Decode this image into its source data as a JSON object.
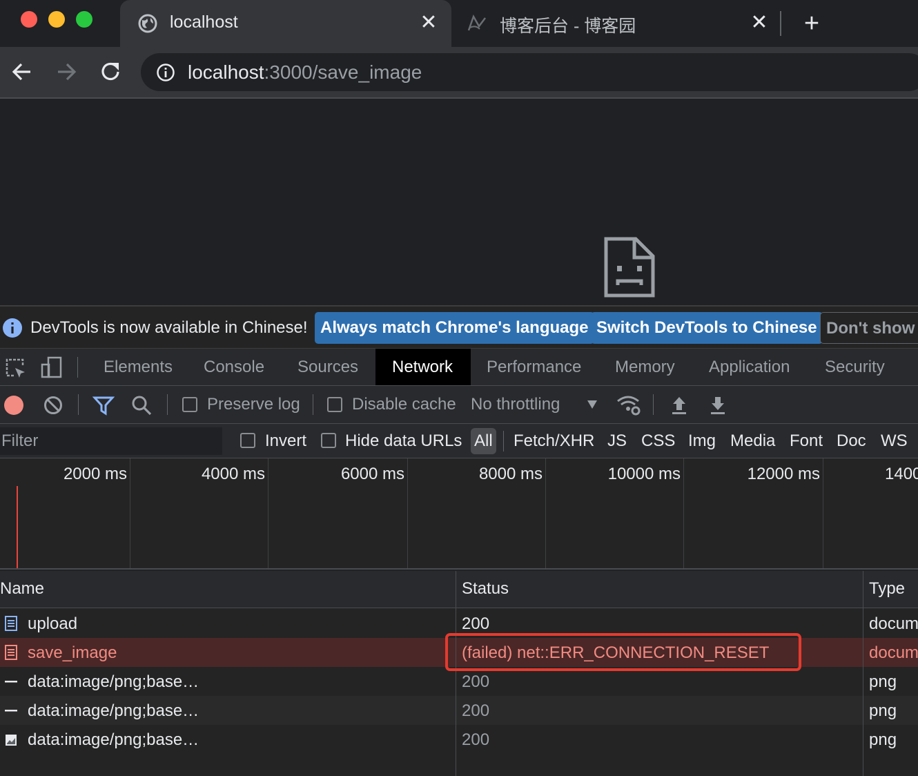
{
  "browser": {
    "tabs": [
      {
        "title": "localhost",
        "active": true
      },
      {
        "title": "博客后台 - 博客园",
        "active": false
      }
    ],
    "url": {
      "host": "localhost",
      "rest": ":3000/save_image"
    }
  },
  "infobar": {
    "message": "DevTools is now available in Chinese!",
    "buttons": [
      "Always match Chrome's language",
      "Switch DevTools to Chinese",
      "Don't show"
    ]
  },
  "devtools": {
    "panels": [
      "Elements",
      "Console",
      "Sources",
      "Network",
      "Performance",
      "Memory",
      "Application",
      "Security"
    ],
    "active_panel": "Network",
    "network_toolbar": {
      "preserve_log": "Preserve log",
      "disable_cache": "Disable cache",
      "throttling": "No throttling"
    },
    "filter": {
      "placeholder": "Filter",
      "invert": "Invert",
      "hide_data_urls": "Hide data URLs",
      "types": [
        "All",
        "Fetch/XHR",
        "JS",
        "CSS",
        "Img",
        "Media",
        "Font",
        "Doc",
        "WS"
      ],
      "active_type": "All"
    },
    "overview_ticks": [
      "2000 ms",
      "4000 ms",
      "6000 ms",
      "8000 ms",
      "10000 ms",
      "12000 ms",
      "1400"
    ],
    "table": {
      "columns": [
        "Name",
        "Status",
        "Type"
      ],
      "rows": [
        {
          "name": "upload",
          "status": "200",
          "type": "docum",
          "icon": "document-icon",
          "error": false
        },
        {
          "name": "save_image",
          "status": "(failed) net::ERR_CONNECTION_RESET",
          "type": "docum",
          "icon": "document-icon",
          "error": true
        },
        {
          "name": "data:image/png;base…",
          "status": "200",
          "type": "png",
          "icon": "dash-image-icon",
          "error": false
        },
        {
          "name": "data:image/png;base…",
          "status": "200",
          "type": "png",
          "icon": "dash-image-icon",
          "error": false
        },
        {
          "name": "data:image/png;base…",
          "status": "200",
          "type": "png",
          "icon": "image-thumb-icon",
          "error": false
        }
      ]
    }
  },
  "colors": {
    "accent": "#1a73e8",
    "error_text": "#f28b82",
    "error_row": "#4b2727",
    "highlight": "#e53a2f",
    "record": "#f28b82",
    "filter_icon": "#8ab4f8"
  }
}
